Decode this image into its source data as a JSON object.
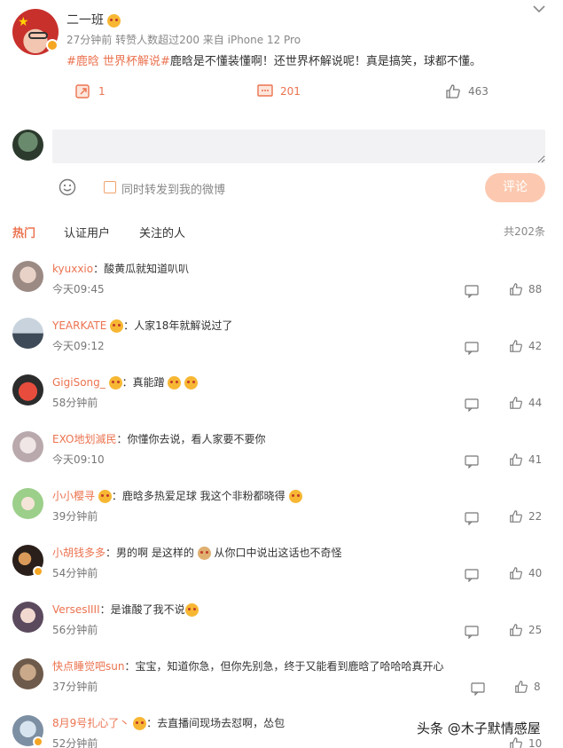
{
  "post": {
    "user": "二一班",
    "meta": "27分钟前  转赞人数超过200  来自 iPhone 12 Pro",
    "topic": "#鹿晗 世界杯解说#",
    "text": "鹿晗是不懂装懂啊！还世界杯解说呢！真是搞笑，球都不懂。",
    "reposts": "1",
    "comments": "201",
    "likes": "463"
  },
  "composer": {
    "placeholder": "",
    "checkbox_label": "同时转发到我的微博",
    "submit_label": "评论"
  },
  "tabs": {
    "hot": "热门",
    "verified": "认证用户",
    "following": "关注的人",
    "total": "共202条"
  },
  "comments": [
    {
      "user": "kyuxxio",
      "text": "：酸黄瓜就知道叭叭",
      "time": "今天09:45",
      "likes": "88"
    },
    {
      "user": "YEARKATE",
      "text": "：人家18年就解说过了",
      "time": "今天09:12",
      "likes": "42"
    },
    {
      "user": "GigiSong_",
      "text": "：真能蹭",
      "time": "58分钟前",
      "likes": "44"
    },
    {
      "user": "EXO地划滅民",
      "text": "：你懂你去说，看人家要不要你",
      "time": "今天09:10",
      "likes": "41"
    },
    {
      "user": "小小樱寻",
      "text": "：鹿晗多热爱足球 我这个非粉都晓得",
      "time": "39分钟前",
      "likes": "22"
    },
    {
      "user": "小胡钱多多",
      "text": "：男的啊 是这样的",
      "text2": "从你口中说出这话也不奇怪",
      "time": "54分钟前",
      "likes": "40"
    },
    {
      "user": "VersesIIII",
      "text": "：是谁酸了我不说",
      "time": "56分钟前",
      "likes": "25"
    },
    {
      "user": "快点睡觉吧sun",
      "text": "：宝宝，知道你急，但你先别急，终于又能看到鹿晗了哈哈哈真开心",
      "time": "37分钟前",
      "likes": "8"
    },
    {
      "user": "8月9号扎心了丶",
      "text": "：去直播间现场去怼啊，怂包",
      "time": "52分钟前",
      "likes": "10"
    }
  ],
  "watermark": "头条 @木子默情感屋",
  "colors": {
    "accent": "#eb7350",
    "submit_bg": "#fcc9b0",
    "input_bg": "#f2f2f5",
    "verified": "#f5a623"
  }
}
